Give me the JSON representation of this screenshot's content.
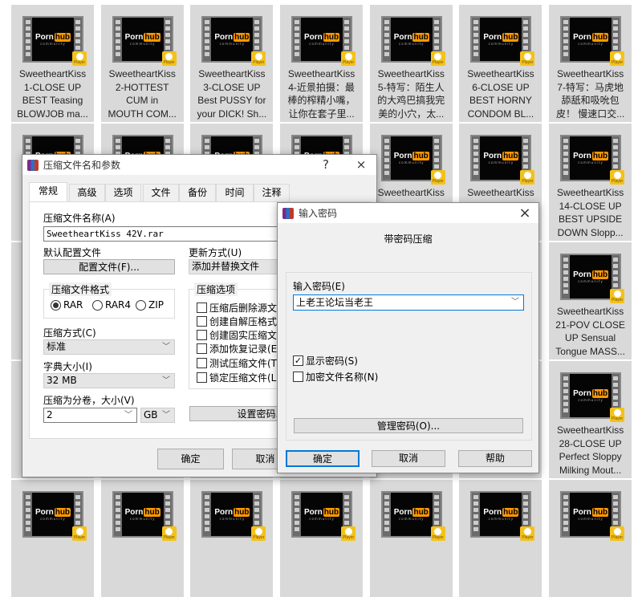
{
  "tiles": [
    {
      "lines": [
        "SweetheartKiss",
        "1-CLOSE UP",
        "BEST Teasing",
        "BLOWJOB ma..."
      ]
    },
    {
      "lines": [
        "SweetheartKiss",
        "2-HOTTEST",
        "CUM in",
        "MOUTH COM..."
      ]
    },
    {
      "lines": [
        "SweetheartKiss",
        "3-CLOSE UP",
        "Best PUSSY for",
        "your DICK! Sh..."
      ]
    },
    {
      "lines": [
        "SweetheartKiss",
        "4-近景拍摄：最",
        "棒的榨精小嘴，",
        "让你在套子里..."
      ]
    },
    {
      "lines": [
        "SweetheartKiss",
        "5-特写：陌生人",
        "的大鸡巴搞我完",
        "美的小穴，太..."
      ]
    },
    {
      "lines": [
        "SweetheartKiss",
        "6-CLOSE UP",
        "BEST HORNY",
        "CONDOM BL..."
      ]
    },
    {
      "lines": [
        "SweetheartKiss",
        "7-特写：马虎地",
        "舔舐和吸吮包",
        "皮！ 慢速口交..."
      ]
    },
    {
      "lines": []
    },
    {
      "lines": []
    },
    {
      "lines": []
    },
    {
      "lines": []
    },
    {
      "lines": [
        "SweetheartKiss"
      ]
    },
    {
      "lines": [
        "SweetheartKiss"
      ]
    },
    {
      "lines": [
        "SweetheartKiss",
        "14-CLOSE UP",
        "BEST UPSIDE",
        "DOWN Slopp..."
      ]
    },
    {
      "lines": []
    },
    {
      "lines": []
    },
    {
      "lines": []
    },
    {
      "lines": []
    },
    {
      "lines": []
    },
    {
      "lines": []
    },
    {
      "lines": [
        "SweetheartKiss",
        "21-POV CLOSE",
        "UP Sensual",
        "Tongue MASS..."
      ]
    },
    {
      "lines": []
    },
    {
      "lines": []
    },
    {
      "lines": []
    },
    {
      "lines": []
    },
    {
      "lines": []
    },
    {
      "lines": []
    },
    {
      "lines": [
        "SweetheartKiss",
        "28-CLOSE UP",
        "Perfect Sloppy",
        "Milking Mout..."
      ]
    },
    {
      "lines": []
    },
    {
      "lines": []
    },
    {
      "lines": []
    },
    {
      "lines": []
    },
    {
      "lines": []
    },
    {
      "lines": []
    },
    {
      "lines": []
    }
  ],
  "thumb": {
    "logo_a": "Porn",
    "logo_b": "hub",
    "sub": "community",
    "badge": "Player",
    "accent": "#ff9900"
  },
  "archive_dialog": {
    "title": "压缩文件名和参数",
    "help": "?",
    "close": "×",
    "tabs": [
      "常规",
      "高级",
      "选项",
      "文件",
      "备份",
      "时间",
      "注释"
    ],
    "filename_label": "压缩文件名称(A)",
    "filename_value": "SweetheartKiss   42V.rar",
    "profile_label": "默认配置文件",
    "profile_button": "配置文件(F)...",
    "update_label": "更新方式(U)",
    "update_value": "添加并替换文件",
    "format_label": "压缩文件格式",
    "formats": [
      "RAR",
      "RAR4",
      "ZIP"
    ],
    "method_label": "压缩方式(C)",
    "method_value": "标准",
    "dict_label": "字典大小(I)",
    "dict_value": "32 MB",
    "volume_label": "压缩为分卷，大小(V)",
    "volume_value": "2",
    "volume_unit": "GB",
    "options_label": "压缩选项",
    "options": [
      "压缩后删除源文件",
      "创建自解压格式压缩文件",
      "创建固实压缩文件",
      "添加恢复记录(E)",
      "测试压缩文件(T)",
      "锁定压缩文件(L)"
    ],
    "set_password": "设置密码...",
    "ok": "确定",
    "cancel": "取消"
  },
  "password_dialog": {
    "title": "输入密码",
    "close": "×",
    "heading": "带密码压缩",
    "input_label": "输入密码(E)",
    "password_value": "上老王论坛当老王",
    "show_password": "显示密码(S)",
    "show_password_checked": true,
    "encrypt_names": "加密文件名称(N)",
    "encrypt_names_checked": false,
    "manage": "管理密码(O)...",
    "ok": "确定",
    "cancel": "取消",
    "help": "帮助",
    "focus_color": "#0078d7"
  }
}
